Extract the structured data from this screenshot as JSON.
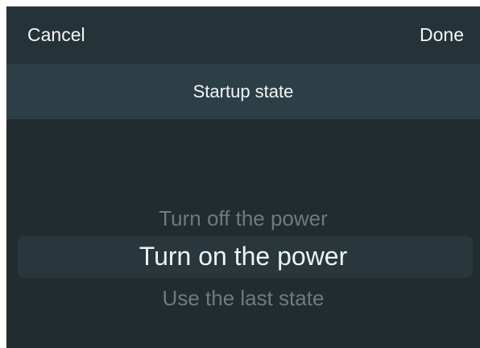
{
  "navbar": {
    "cancel_label": "Cancel",
    "done_label": "Done"
  },
  "title": "Startup state",
  "picker": {
    "options": [
      "Turn off the power",
      "Turn on the power",
      "Use the last state"
    ],
    "selected": "Turn on the power"
  },
  "colors": {
    "background": "#212c31",
    "navbar": "#253338",
    "title_bar": "#2c3f46",
    "selection_highlight": "#29363b",
    "text_primary": "#f2f5f6",
    "text_dim": "#6b7b81"
  }
}
